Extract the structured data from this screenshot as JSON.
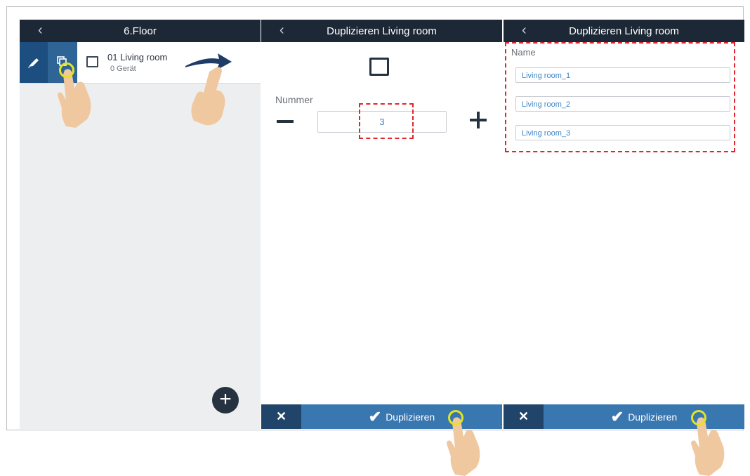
{
  "panel1": {
    "header_title": "6.Floor",
    "back_icon": "chevron-left-icon",
    "room": {
      "title": "01 Living room",
      "subtitle": "0 Gerät"
    },
    "edit_icon": "pencil-icon",
    "duplicate_icon": "duplicate-icon",
    "add_label": "+"
  },
  "panel2": {
    "header_title": "Duplizieren Living room",
    "number_label": "Nummer",
    "number_value": "3",
    "cancel_label": "✕",
    "confirm_label": "Duplizieren"
  },
  "panel3": {
    "header_title": "Duplizieren Living room",
    "name_label": "Name",
    "names": [
      "Living room_1",
      "Living room_2",
      "Living room_3"
    ],
    "cancel_label": "✕",
    "confirm_label": "Duplizieren"
  },
  "colors": {
    "header": "#1d2836",
    "action_blue": "#3977b1",
    "cancel_blue": "#21446b",
    "highlight": "#e0252c",
    "value_text": "#3d86c6"
  }
}
